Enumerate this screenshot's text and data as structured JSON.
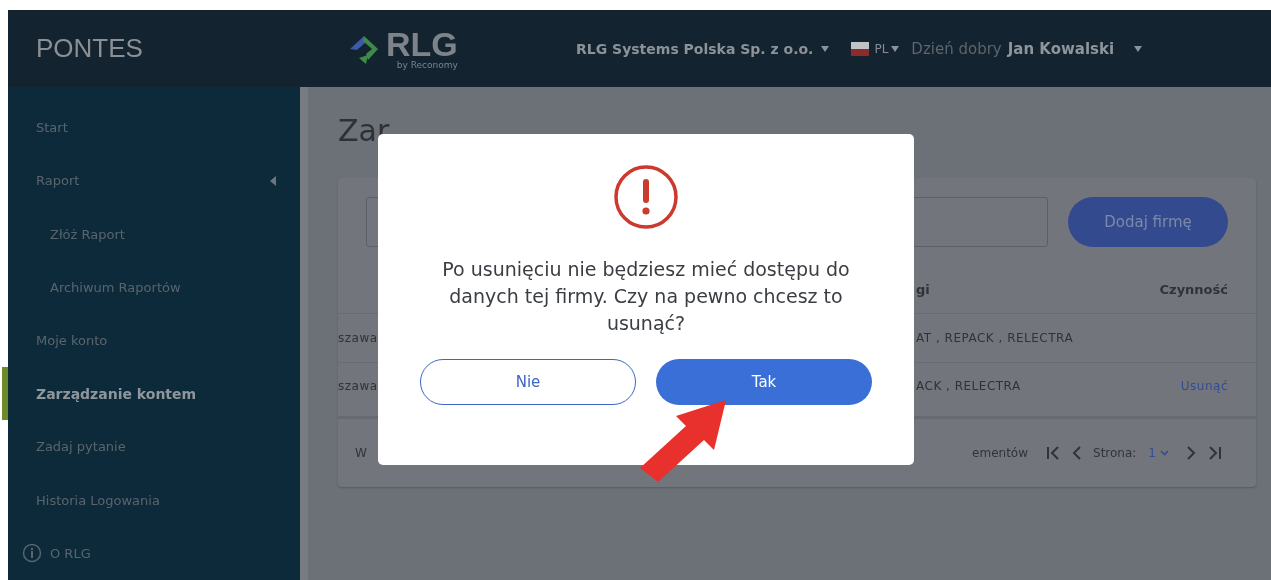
{
  "header": {
    "app_name": "PONTES",
    "logo_text": "RLG",
    "logo_subtext": "by Reconomy",
    "company": "RLG Systems Polska Sp. z o.o.",
    "language": "PL",
    "greeting": "Dzień dobry",
    "user_name": "Jan Kowalski"
  },
  "sidebar": {
    "items": [
      {
        "label": "Start",
        "selected": false
      },
      {
        "label": "Raport",
        "selected": false,
        "expanded": true,
        "children": [
          {
            "label": "Złóż Raport",
            "selected": false
          },
          {
            "label": "Archiwum Raportów",
            "selected": false
          }
        ]
      },
      {
        "label": "Moje konto",
        "selected": false
      },
      {
        "label": "Zarządzanie kontem",
        "selected": true
      },
      {
        "label": "Zadaj pytanie",
        "selected": false
      },
      {
        "label": "Historia Logowania",
        "selected": false
      },
      {
        "label": "O RLG",
        "selected": false,
        "kind": "info"
      }
    ]
  },
  "page": {
    "title": "Zar",
    "add_button": "Dodaj firmę",
    "table": {
      "columns": [
        "",
        "gi",
        "Czynność"
      ],
      "rows": [
        [
          "szawa",
          "AT , REPACK , RELECTRA",
          ""
        ],
        [
          "szawa",
          "ACK , RELECTRA",
          "Usunąć"
        ]
      ]
    },
    "footer": {
      "left": "W",
      "count": "ementów",
      "page_label": "Strona:",
      "page": "1"
    }
  },
  "dialog": {
    "message": "Po usunięciu nie będziesz mieć dostępu do danych tej firmy. Czy na pewno chcesz to usunąć?",
    "buttons": [
      {
        "label": "Nie",
        "kind": "secondary"
      },
      {
        "label": "Tak",
        "kind": "primary"
      }
    ]
  }
}
